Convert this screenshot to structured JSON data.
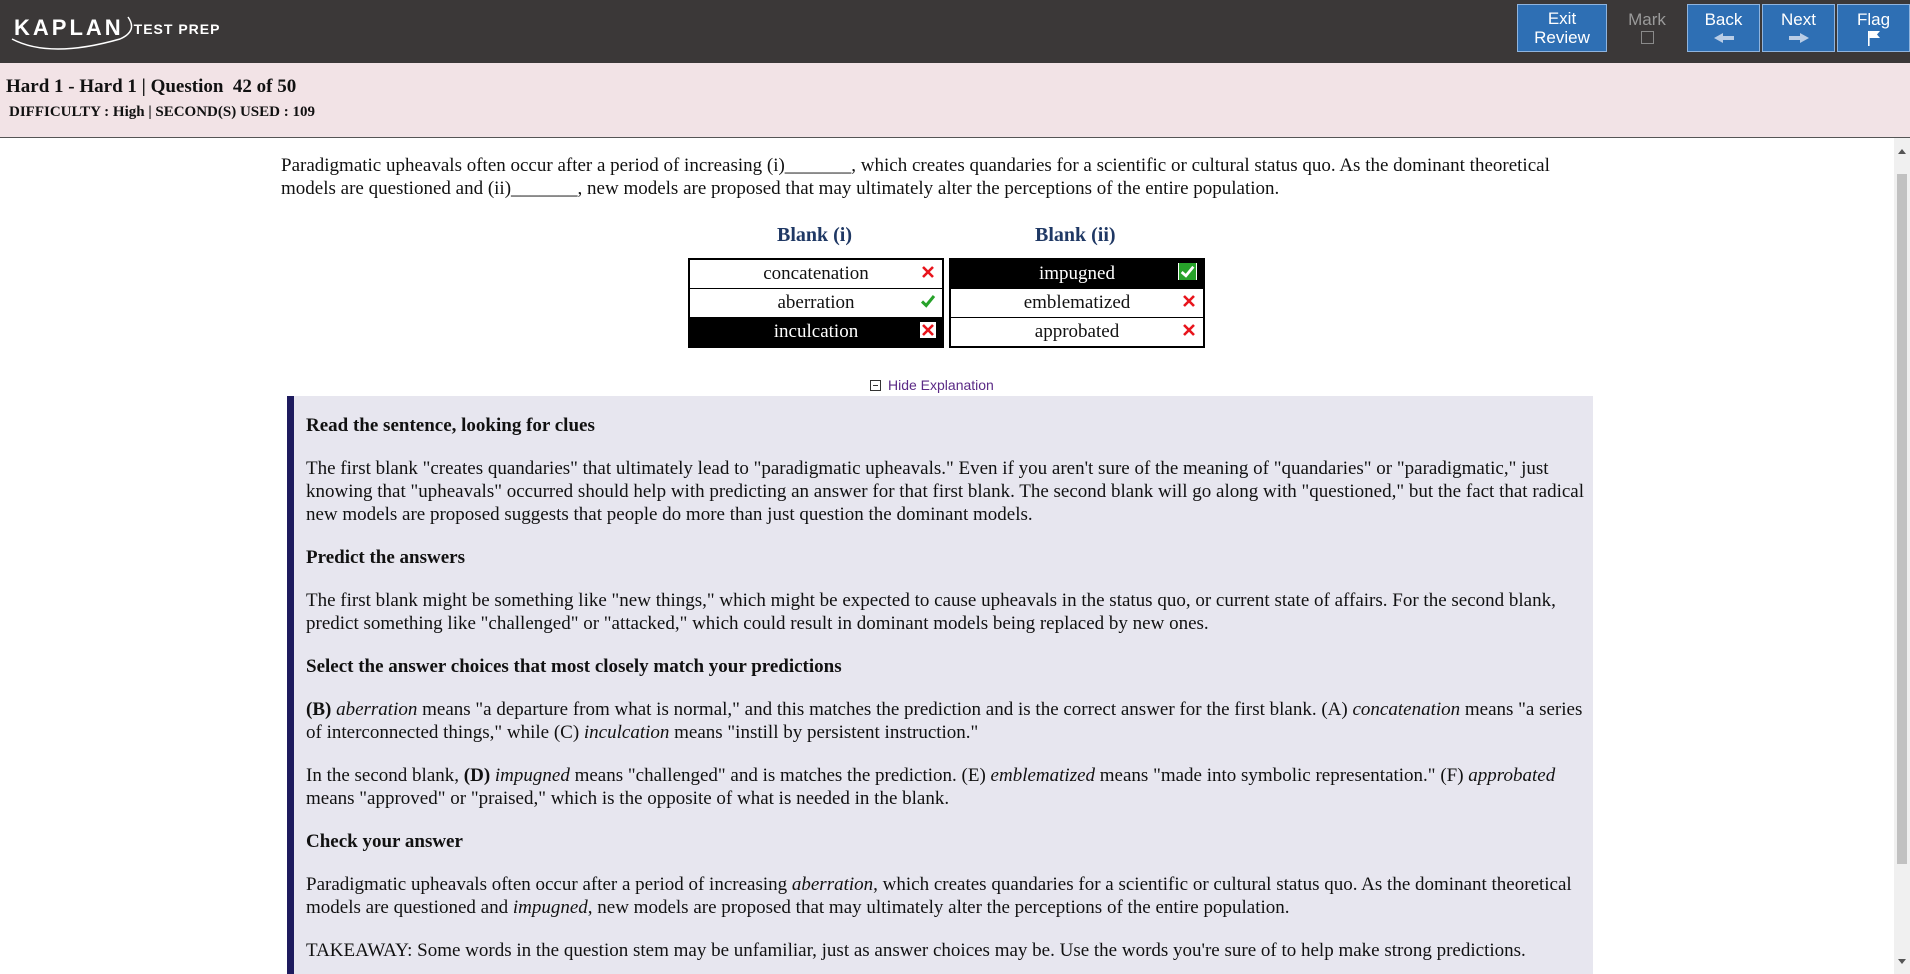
{
  "logo": {
    "word": "KAPLAN",
    "sub": "TEST PREP"
  },
  "toolbar": {
    "exit": {
      "line1": "Exit",
      "line2": "Review"
    },
    "mark": {
      "label": "Mark"
    },
    "back": {
      "label": "Back"
    },
    "next": {
      "label": "Next"
    },
    "flag": {
      "label": "Flag"
    }
  },
  "header": {
    "title": "Hard 1 - Hard 1 | Question  42 of 50",
    "subtitle": "DIFFICULTY : High | SECOND(S) USED : 109"
  },
  "question": {
    "stem": "Paradigmatic upheavals often occur after a period of increasing (i)_______, which creates quandaries for a scientific or cultural status quo. As the dominant theoretical models are questioned and (ii)_______, new models are proposed that may ultimately alter the perceptions of the entire population.",
    "blank1": {
      "header": "Blank (i)",
      "options": [
        {
          "label": "concatenation",
          "selected": false,
          "mark": "wrong"
        },
        {
          "label": "aberration",
          "selected": false,
          "mark": "correct"
        },
        {
          "label": "inculcation",
          "selected": true,
          "mark": "wrong"
        }
      ]
    },
    "blank2": {
      "header": "Blank (ii)",
      "options": [
        {
          "label": "impugned",
          "selected": true,
          "mark": "correct"
        },
        {
          "label": "emblematized",
          "selected": false,
          "mark": "wrong"
        },
        {
          "label": "approbated",
          "selected": false,
          "mark": "wrong"
        }
      ]
    },
    "hide_explanation": "Hide Explanation"
  },
  "explanation": {
    "h1": "Read the sentence, looking for clues",
    "p1": "The first blank \"creates quandaries\" that ultimately lead to \"paradigmatic upheavals.\" Even if you aren't sure of the meaning of \"quandaries\" or \"paradigmatic,\" just knowing that \"upheavals\" occurred should help with predicting an answer for that first blank. The second blank will go along with \"questioned,\" but the fact that radical new models are proposed suggests that people do more than just question the dominant models.",
    "h2": "Predict the answers",
    "p2": "The first blank might be something like \"new things,\" which might be expected to cause upheavals in the status quo, or current state of affairs. For the second blank, predict something like \"challenged\" or \"attacked,\" which could result in dominant models being replaced by new ones.",
    "h3": "Select the answer choices that most closely match your predictions",
    "p3": {
      "a": "(B)",
      "b": "aberration",
      "c": " means \"a departure from what is normal,\" and this matches the prediction and is the correct answer for the first blank. (A) ",
      "d": "concatenation",
      "e": " means \"a series of interconnected things,\" while (C) ",
      "f": "inculcation",
      "g": " means \"instill by persistent instruction.\""
    },
    "p4": {
      "a": "In the second blank, ",
      "b": "(D)",
      "c": "impugned",
      "d": " means \"challenged\" and is matches the prediction. (E) ",
      "e": "emblematized",
      "f": " means \"made into symbolic representation.\" (F) ",
      "g": "approbated",
      "h": " means \"approved\" or \"praised,\" which is the opposite of what is needed in the blank."
    },
    "h4": "Check your answer",
    "p5": {
      "a": "Paradigmatic upheavals often occur after a period of increasing ",
      "b": "aberration",
      "c": ", which creates quandaries for a scientific or cultural status quo. As the dominant theoretical models are questioned and ",
      "d": "impugned",
      "e": ", new models are proposed that may ultimately alter the perceptions of the entire population."
    },
    "p6": "TAKEAWAY: Some words in the question stem may be unfamiliar, just as answer choices may be. Use the words you're sure of to help make strong predictions."
  },
  "colors": {
    "topbar": "#3b3838",
    "button": "#2e6fb4",
    "header_bg": "#f2e3e6",
    "explanation_bg": "#e7e6ef",
    "correct": "#27a22a",
    "wrong": "#e8141c"
  }
}
